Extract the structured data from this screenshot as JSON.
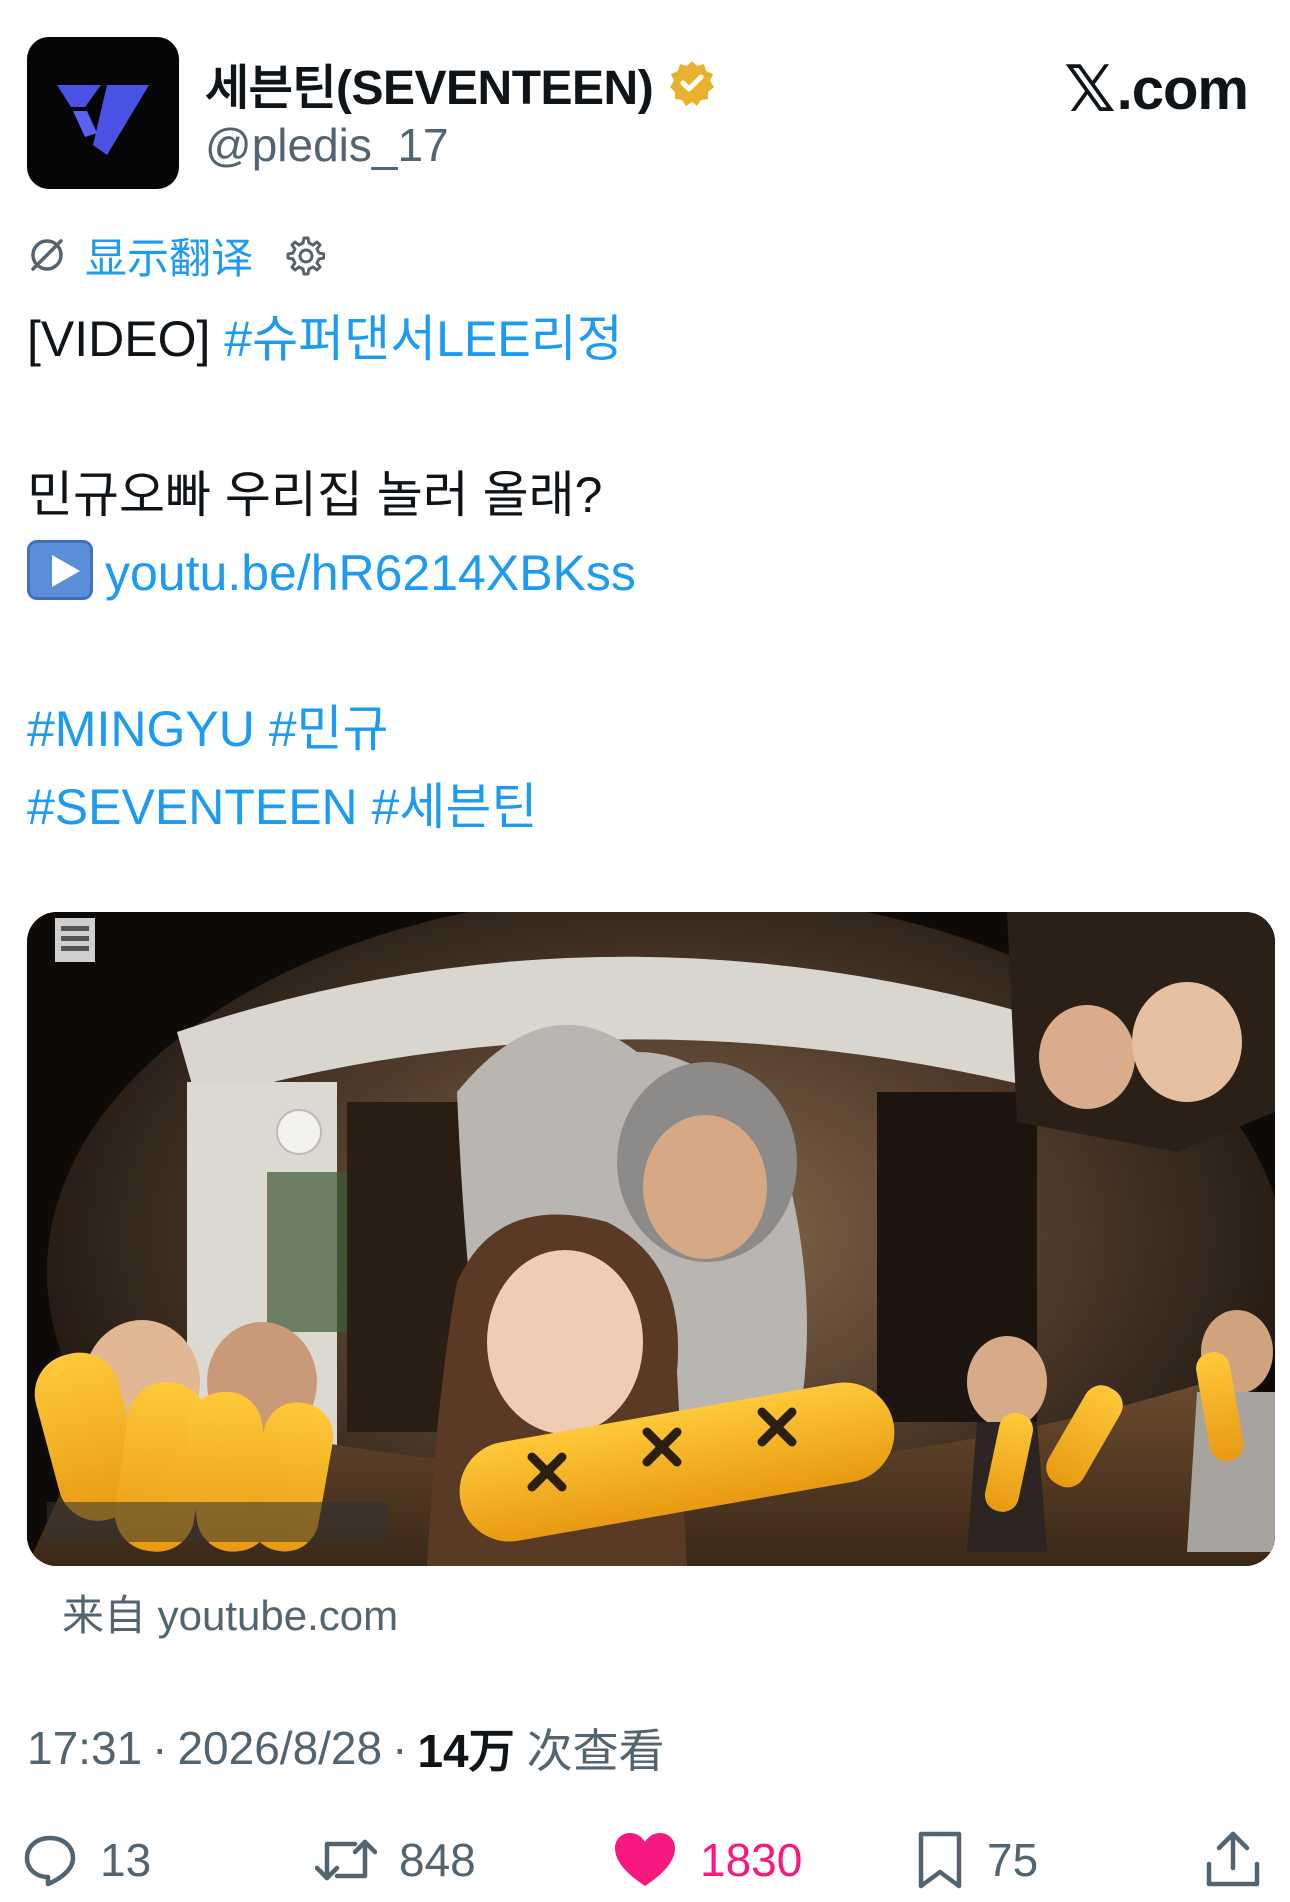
{
  "account": {
    "display_name": "세븐틴(SEVENTEEN)",
    "handle": "@pledis_17",
    "verified_badge": "verified-gold-badge"
  },
  "brand": {
    "label": ".com",
    "glyph": "𝕏"
  },
  "translate": {
    "label": "显示翻译"
  },
  "tweet": {
    "prefix": "[VIDEO] ",
    "hashtag1": "#슈퍼댄서LEE리정",
    "line2": "민규오빠 우리집 놀러 올래?",
    "link": "youtu.be/hR6214XBKss",
    "hashtag_line1": "#MINGYU #민규",
    "hashtag_line2": "#SEVENTEEN #세븐틴"
  },
  "media": {
    "source": "来自 youtube.com"
  },
  "meta": {
    "time": "17:31",
    "date": "2026/8/28",
    "sep": "·",
    "views_count": "14万",
    "views_label": "次查看"
  },
  "actions": {
    "replies": "13",
    "reposts": "848",
    "likes": "1830",
    "bookmarks": "75"
  },
  "colors": {
    "accent": "#1d9bf0",
    "like": "#f91880",
    "secondary_text": "#536471",
    "verified": "#e8b22f"
  }
}
